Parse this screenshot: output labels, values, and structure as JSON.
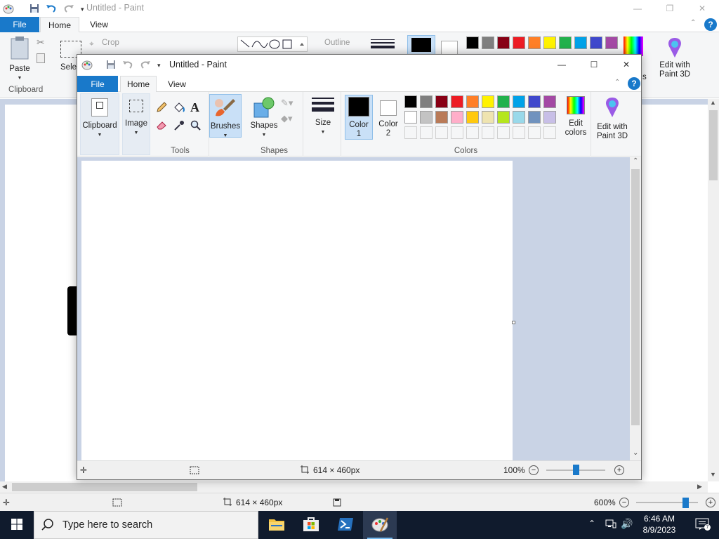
{
  "bg_window": {
    "title": "Untitled - Paint",
    "tabs": {
      "file": "File",
      "home": "Home",
      "view": "View"
    },
    "ribbon": {
      "paste": "Paste",
      "select": "Selec",
      "crop": "Crop",
      "outline": "Outline",
      "group_clipboard": "Clipboard",
      "edit_paint3d_line1": "Edit with",
      "edit_paint3d_line2": "Paint 3D",
      "partial_s": "s"
    },
    "status": {
      "dimensions": "614 × 460px",
      "zoom": "600%"
    }
  },
  "fg_window": {
    "title": "Untitled - Paint",
    "tabs": {
      "file": "File",
      "home": "Home",
      "view": "View"
    },
    "groups": {
      "clipboard": "Clipboard",
      "image": "Image",
      "tools": "Tools",
      "brushes": "Brushes",
      "shapes_btn": "Shapes",
      "shapes": "Shapes",
      "size": "Size",
      "color1_line1": "Color",
      "color1_line2": "1",
      "color2_line1": "Color",
      "color2_line2": "2",
      "colors": "Colors",
      "edit_colors_line1": "Edit",
      "edit_colors_line2": "colors",
      "paint3d_line1": "Edit with",
      "paint3d_line2": "Paint 3D"
    },
    "palette_row1": [
      "#000000",
      "#7f7f7f",
      "#880015",
      "#ed1c24",
      "#ff7f27",
      "#fff200",
      "#22b14c",
      "#00a2e8",
      "#3f48cc",
      "#a349a4"
    ],
    "palette_row2": [
      "#ffffff",
      "#c3c3c3",
      "#b97a57",
      "#ffaec9",
      "#ffc90e",
      "#efe4b0",
      "#b5e61d",
      "#99d9ea",
      "#7092be",
      "#c8bfe7"
    ],
    "color1": "#000000",
    "color2": "#ffffff",
    "status": {
      "dimensions": "614 × 460px",
      "zoom": "100%"
    }
  },
  "taskbar": {
    "search_placeholder": "Type here to search",
    "time": "6:46 AM",
    "date": "8/9/2023"
  }
}
